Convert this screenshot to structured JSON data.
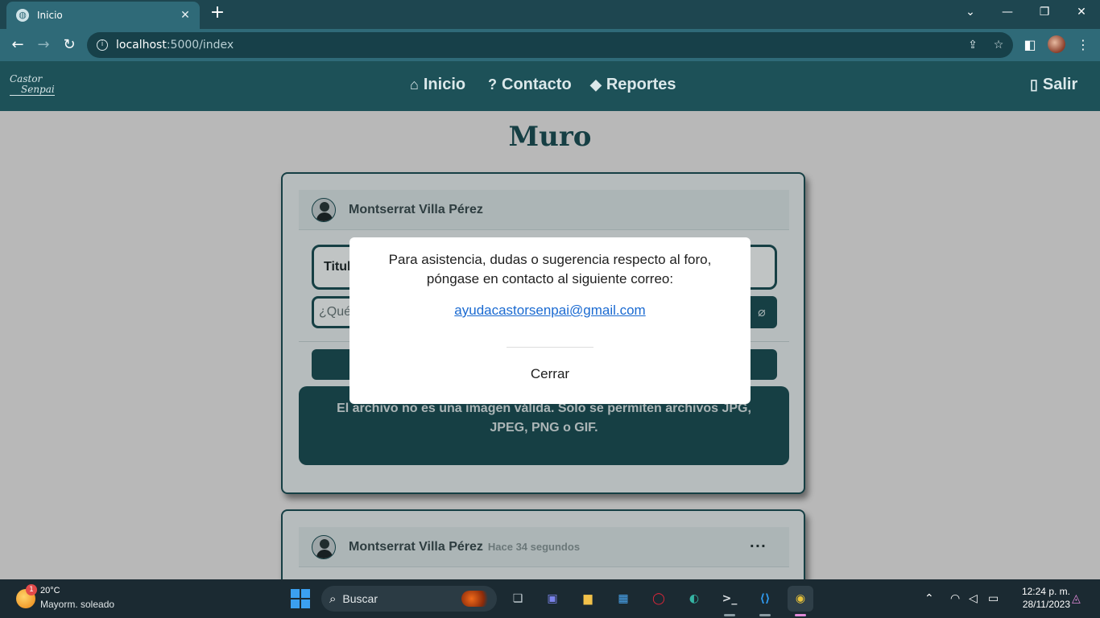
{
  "browser": {
    "tab_title": "Inicio",
    "new_tab": "+",
    "url_host": "localhost",
    "url_path": ":5000/index"
  },
  "site": {
    "logo_line1": "Castor",
    "logo_line2": "Senpai",
    "nav": [
      {
        "label": "Inicio",
        "icon": "home-icon"
      },
      {
        "label": "Contacto",
        "icon": "question-icon"
      },
      {
        "label": "Reportes",
        "icon": "alert-diamond-icon"
      }
    ],
    "logout": "Salir"
  },
  "page": {
    "title": "Muro"
  },
  "composer": {
    "user": "Montserrat Villa Pérez",
    "title_placeholder": "Titul",
    "content_placeholder": "¿Qué",
    "error": "El archivo no es una imagen válida. Solo se permiten archivos JPG, JPEG, PNG o GIF."
  },
  "post": {
    "user": "Montserrat Villa Pérez",
    "time": "Hace 34 segundos",
    "menu": "···"
  },
  "modal": {
    "message": "Para asistencia, dudas o sugerencia respecto al foro, póngase en contacto al siguiente correo:",
    "email": "ayudacastorsenpai@gmail.com",
    "close": "Cerrar"
  },
  "taskbar": {
    "weather_badge": "1",
    "temperature": "20°C",
    "weather": "Mayorm. soleado",
    "search": "Buscar",
    "time": "12:24 p. m.",
    "date": "28/11/2023"
  },
  "colors": {
    "brand": "#1d5158",
    "link": "#1a6ad1",
    "chrome": "#2f6a78"
  }
}
